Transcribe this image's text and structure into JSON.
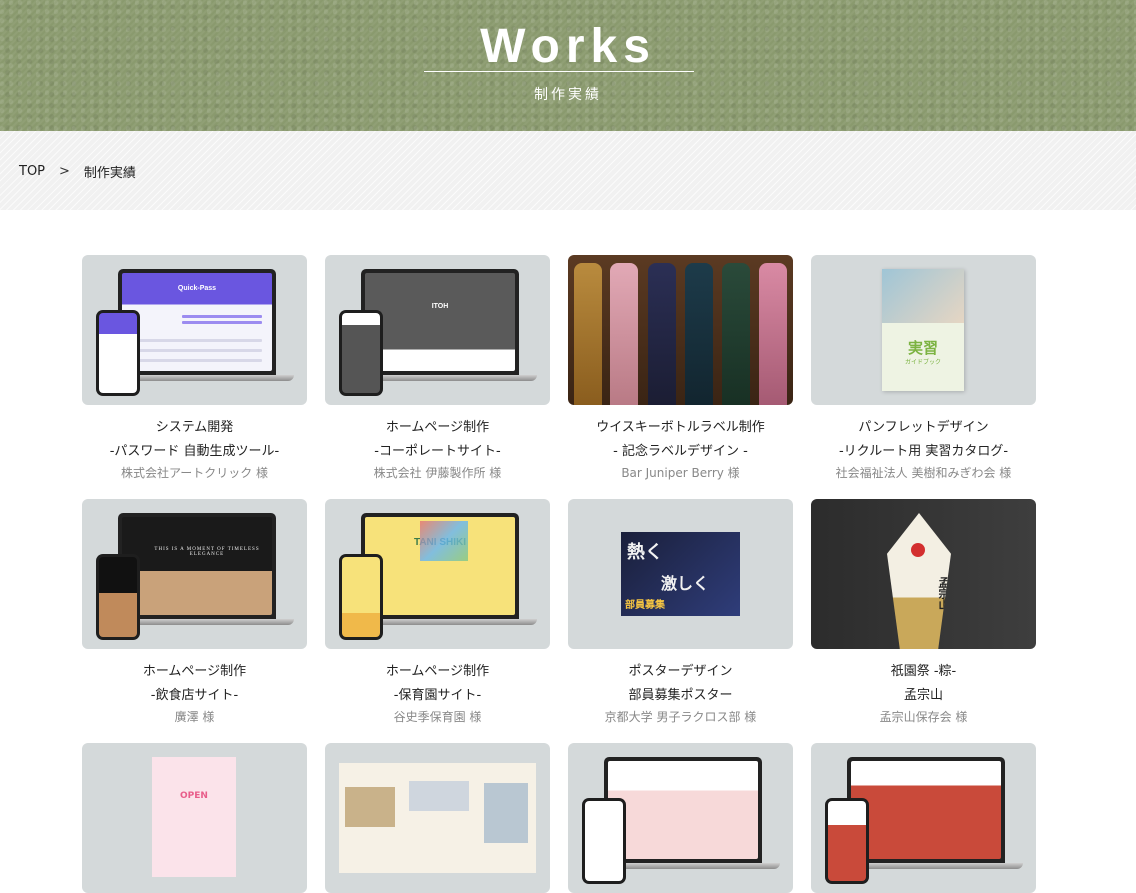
{
  "hero": {
    "title": "Works",
    "subtitle": "制作実績"
  },
  "breadcrumb": {
    "home": "TOP",
    "separator": ">",
    "current": "制作実績"
  },
  "works": [
    {
      "category": "システム開発",
      "subtitle": "-パスワード 自動生成ツール-",
      "client": "株式会社アートクリック 様"
    },
    {
      "category": "ホームページ制作",
      "subtitle": "-コーポレートサイト-",
      "client": "株式会社 伊藤製作所 様"
    },
    {
      "category": "ウイスキーボトルラベル制作",
      "subtitle": "- 記念ラベルデザイン -",
      "client": "Bar Juniper Berry 様"
    },
    {
      "category": "パンフレットデザイン",
      "subtitle": "-リクルート用 実習カタログ-",
      "client": "社会福祉法人 美樹和みぎわ会 様"
    },
    {
      "category": "ホームページ制作",
      "subtitle": "-飲食店サイト-",
      "client": "廣澤 様"
    },
    {
      "category": "ホームページ制作",
      "subtitle": "-保育園サイト-",
      "client": "谷史季保育園 様"
    },
    {
      "category": "ポスターデザイン",
      "subtitle": "部員募集ポスター",
      "client": "京都大学 男子ラクロス部 様"
    },
    {
      "category": "祇園祭 -粽-",
      "subtitle": "孟宗山",
      "client": "孟宗山保存会 様"
    }
  ],
  "thumb_text": {
    "quickpass": "Quick-Pass",
    "itoh": "ITOH",
    "timeless": "THIS IS A MOMENT OF TIMELESS ELEGANCE",
    "tanishiki": "TANI SHIKI",
    "poster_a": "熱く",
    "poster_b": "激しく",
    "poster_c": "部員募集",
    "catalog_a": "実習",
    "catalog_b": "ガイドブック",
    "chimaki": "孟宗山",
    "open": "OPEN"
  },
  "colors": {
    "hero_bg": "#8a9a6e",
    "breadcrumb_bg": "#f1f1f1",
    "client_text": "#888888"
  }
}
